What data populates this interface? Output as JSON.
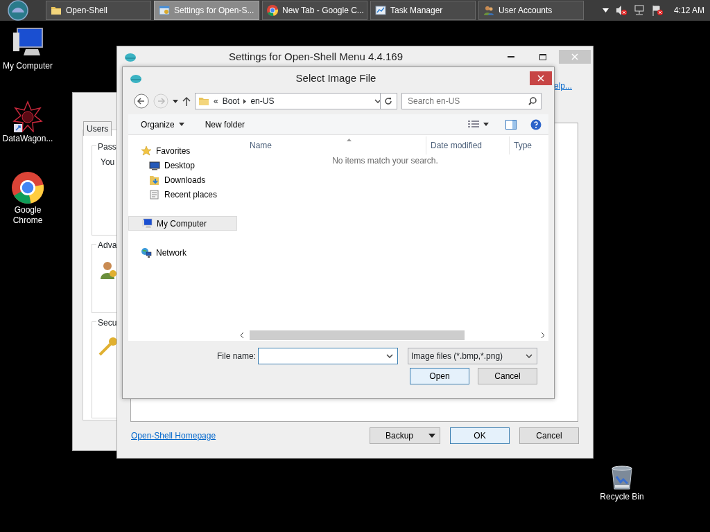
{
  "taskbar": {
    "tasks": [
      {
        "label": "Open-Shell",
        "kind": "folder",
        "selected": false
      },
      {
        "label": "Settings for Open-S...",
        "kind": "settings",
        "selected": true
      },
      {
        "label": "New Tab - Google C...",
        "kind": "chrome",
        "selected": false
      },
      {
        "label": "Task Manager",
        "kind": "taskmgr",
        "selected": false
      },
      {
        "label": "User Accounts",
        "kind": "users",
        "selected": false
      }
    ],
    "clock": "4:12 AM"
  },
  "desktop_icons": [
    {
      "label": "My Computer",
      "kind": "computer"
    },
    {
      "label": "DataWagon...",
      "kind": "star"
    },
    {
      "label": "Google Chrome",
      "kind": "chrome"
    },
    {
      "label": "Recycle Bin",
      "kind": "bin"
    }
  ],
  "user_accounts_window": {
    "tabs": [
      {
        "label": "Users",
        "selected": false
      }
    ],
    "groups": [
      {
        "title": "Pass",
        "text": "You"
      },
      {
        "title": "Adva"
      },
      {
        "title": "Secu"
      }
    ]
  },
  "settings_window": {
    "title": "Settings for Open-Shell Menu 4.4.169",
    "help_link": "elp...",
    "homepage_link": "Open-Shell Homepage",
    "buttons": [
      {
        "label": "Backup",
        "kind": "split"
      },
      {
        "label": "OK",
        "kind": "default"
      },
      {
        "label": "Cancel",
        "kind": "plain"
      }
    ]
  },
  "dialog": {
    "title": "Select Image File",
    "breadcrumb": [
      "«",
      "Boot",
      "en-US"
    ],
    "search": {
      "placeholder": "Search en-US"
    },
    "toolbar": {
      "organize": "Organize",
      "new_folder": "New folder"
    },
    "nav": [
      {
        "label": "Favorites",
        "kind": "star",
        "selected": false,
        "children": [
          {
            "label": "Desktop",
            "kind": "desktop",
            "selected": false
          },
          {
            "label": "Downloads",
            "kind": "downloads",
            "selected": false
          },
          {
            "label": "Recent places",
            "kind": "recent",
            "selected": false
          }
        ]
      },
      {
        "label": "My Computer",
        "kind": "computer",
        "selected": true
      },
      {
        "label": "Network",
        "kind": "network",
        "selected": false
      }
    ],
    "columns": [
      "Name",
      "Date modified",
      "Type"
    ],
    "empty_message": "No items match your search.",
    "file_name_label": "File name:",
    "file_type": "Image files (*.bmp,*.png)",
    "buttons": [
      {
        "label": "Open",
        "kind": "default"
      },
      {
        "label": "Cancel",
        "kind": "plain"
      }
    ]
  }
}
